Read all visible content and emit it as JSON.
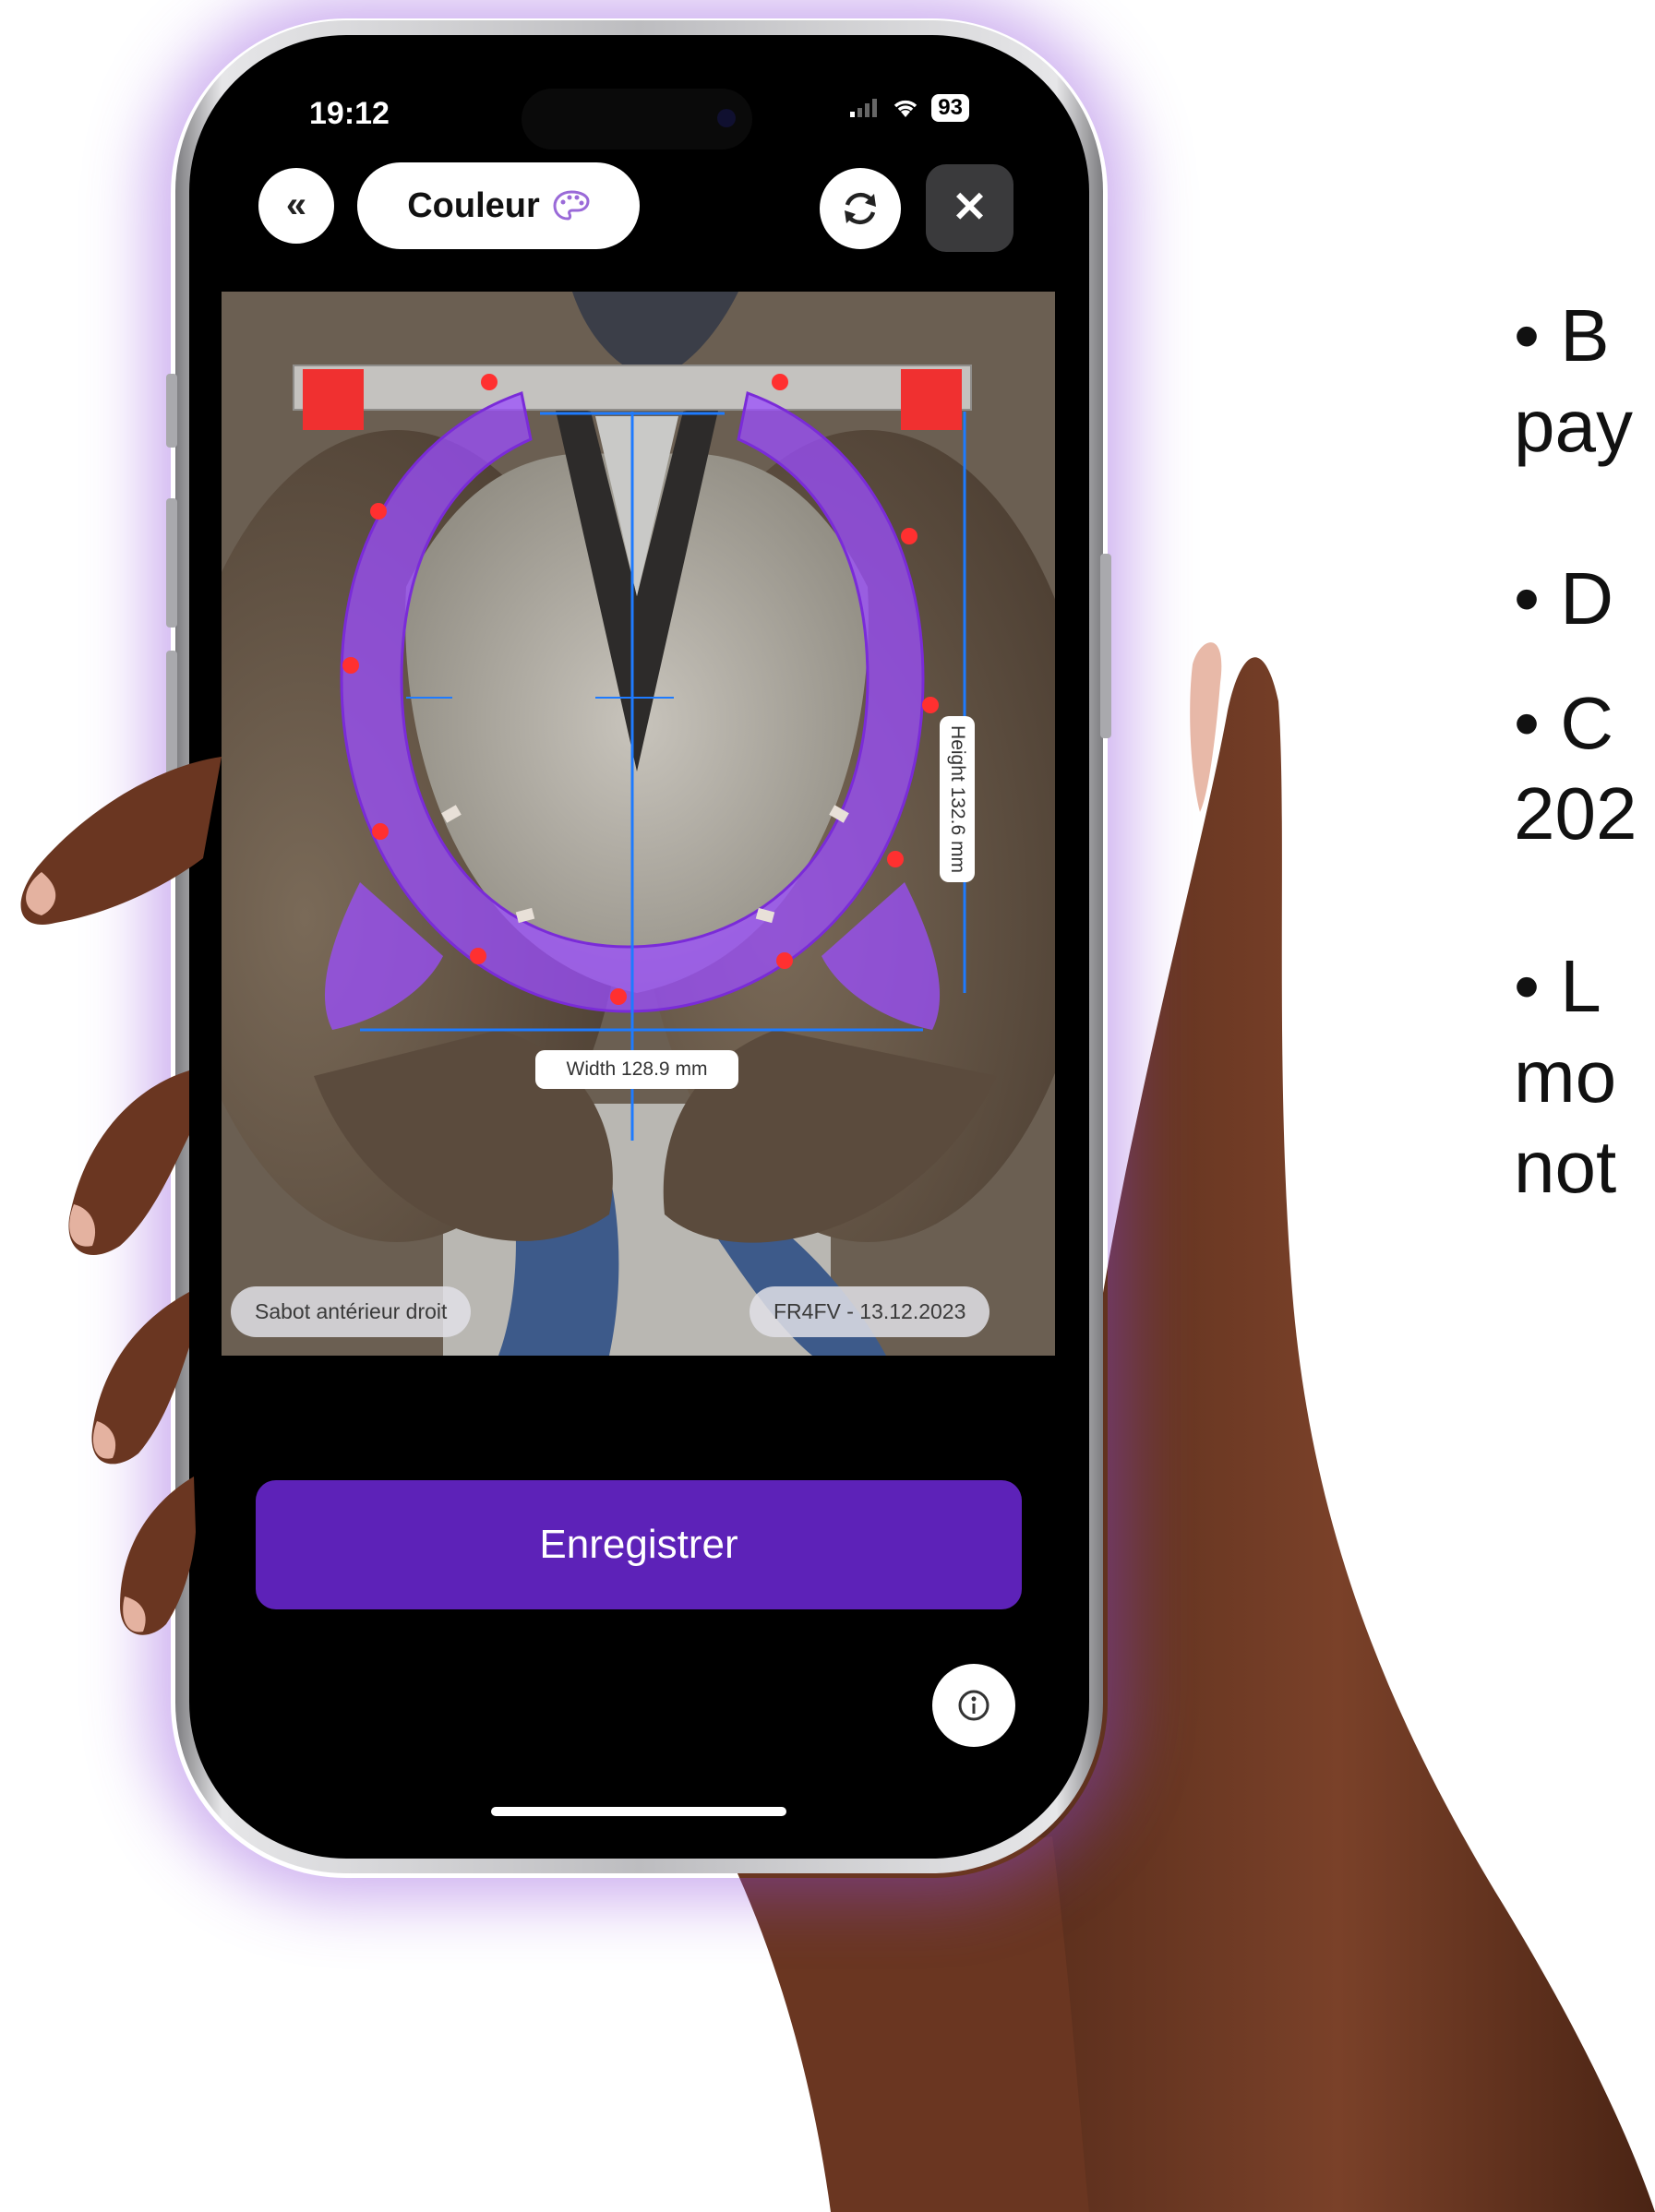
{
  "status_bar": {
    "time": "19:12",
    "battery": "93"
  },
  "toolbar": {
    "back_label": "«",
    "mode_label": "Couleur",
    "close_label": "✕"
  },
  "measurements": {
    "height_label": "Height 132.6 mm",
    "width_label": "Width 128.9 mm"
  },
  "photo_labels": {
    "hoof_position": "Sabot antérieur droit",
    "record_id": "FR4FV - 13.12.2023"
  },
  "actions": {
    "save_label": "Enregistrer",
    "info_label": "i"
  },
  "side_text": {
    "lines": [
      "• B",
      "pay",
      "• D",
      "• C",
      "202",
      "• L",
      "mo",
      "not"
    ]
  },
  "colors": {
    "accent": "#5d22b8",
    "overlay_purple": "#9b4dff",
    "guide_blue": "#1e7bff",
    "marker_red": "#ff3030"
  },
  "icons": [
    "back-icon",
    "palette-icon",
    "refresh-icon",
    "close-icon",
    "info-icon",
    "wifi-icon",
    "signal-icon",
    "battery-icon"
  ]
}
